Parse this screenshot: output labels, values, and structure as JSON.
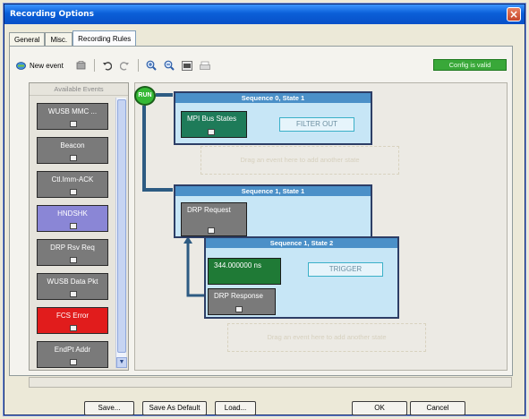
{
  "window": {
    "title": "Recording Options"
  },
  "tabs": [
    {
      "label": "General"
    },
    {
      "label": "Misc."
    },
    {
      "label": "Recording Rules"
    }
  ],
  "toolbar": {
    "new_event_label": "New event",
    "config_status": "Config is valid"
  },
  "events": {
    "header": "Available Events",
    "items": [
      {
        "label": "WUSB MMC ...",
        "color": "#7a7a7a"
      },
      {
        "label": "Beacon",
        "color": "#7a7a7a"
      },
      {
        "label": "Ctl.Imm-ACK",
        "color": "#7a7a7a"
      },
      {
        "label": "HNDSHK",
        "color": "#8a86d6"
      },
      {
        "label": "DRP Rsv Req",
        "color": "#7a7a7a"
      },
      {
        "label": "WUSB Data Pkt",
        "color": "#7a7a7a"
      },
      {
        "label": "FCS Error",
        "color": "#e11c1c"
      },
      {
        "label": "EndPt Addr",
        "color": "#7a7a7a"
      }
    ]
  },
  "canvas": {
    "run_label": "RUN",
    "seq0": {
      "title": "Sequence 0, State 1",
      "state_label": "MPI Bus States",
      "action_label": "FILTER OUT",
      "drop_hint": "Drag an event here to add another state"
    },
    "seq1a": {
      "title": "Sequence 1, State 1",
      "state_label": "DRP Request"
    },
    "seq1b": {
      "title": "Sequence 1, State 2",
      "timer_label": "344.000000 ns",
      "action_label": "TRIGGER",
      "response_label": "DRP Response",
      "drop_hint": "Drag an event here to add another state"
    }
  },
  "buttons": {
    "save": "Save...",
    "save_default": "Save As Default",
    "load": "Load...",
    "ok": "OK",
    "cancel": "Cancel"
  }
}
